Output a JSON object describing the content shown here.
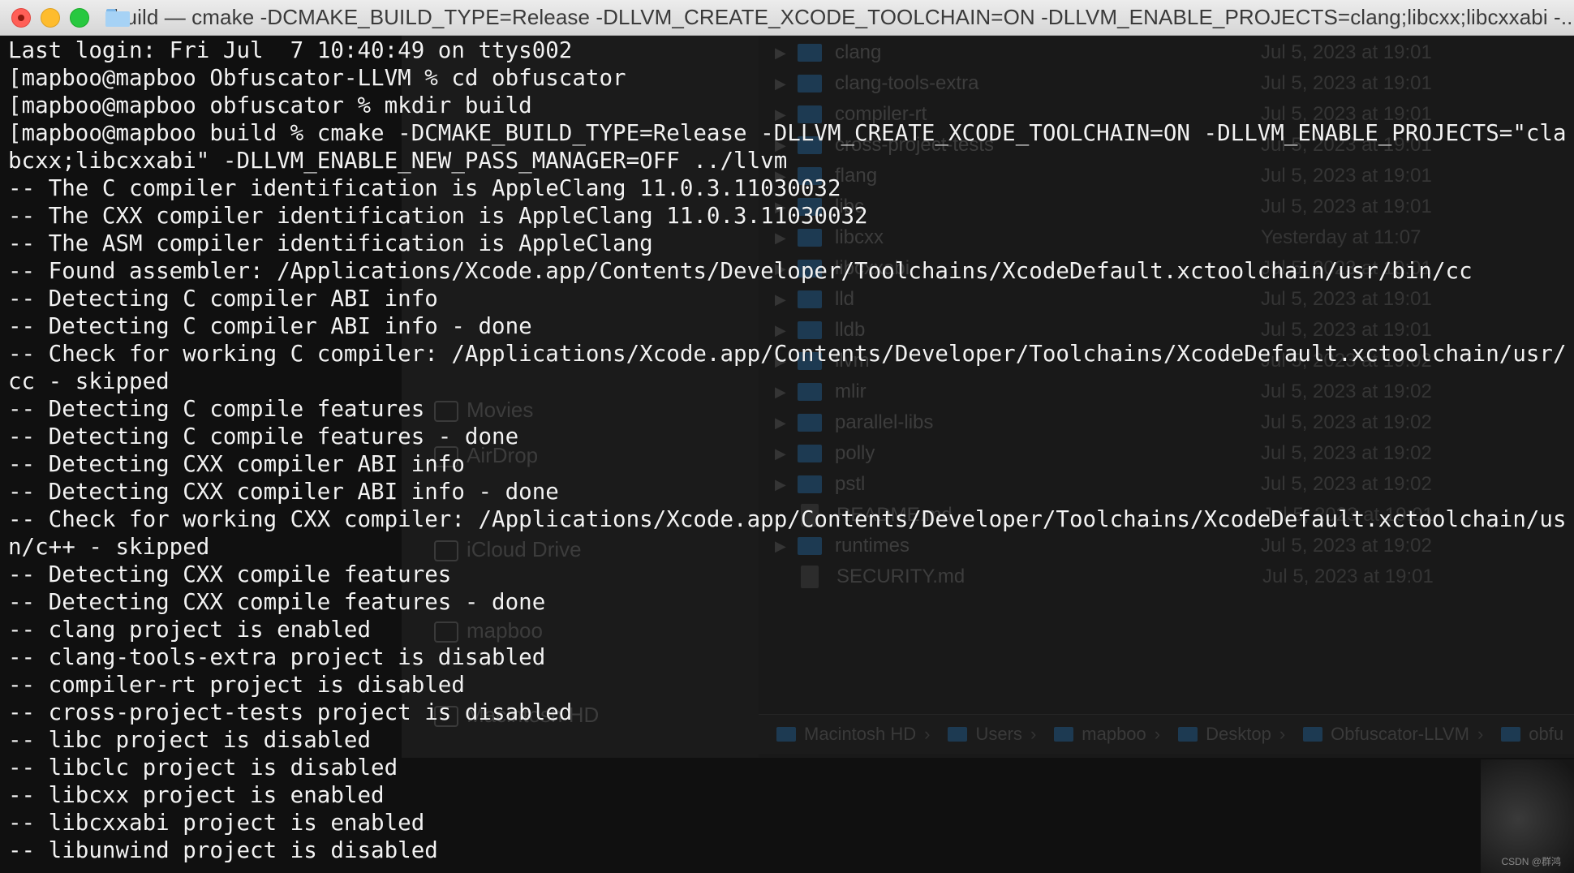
{
  "window": {
    "title": "build — cmake -DCMAKE_BUILD_TYPE=Release -DLLVM_CREATE_XCODE_TOOLCHAIN=ON -DLLVM_ENABLE_PROJECTS=clang;libcxx;libcxxabi -..."
  },
  "terminal": {
    "lines": [
      "Last login: Fri Jul  7 10:40:49 on ttys002",
      "[mapboo@mapboo Obfuscator-LLVM % cd obfuscator",
      "[mapboo@mapboo obfuscator % mkdir build",
      "[mapboo@mapboo build % cmake -DCMAKE_BUILD_TYPE=Release -DLLVM_CREATE_XCODE_TOOLCHAIN=ON -DLLVM_ENABLE_PROJECTS=\"clang;li",
      "bcxx;libcxxabi\" -DLLVM_ENABLE_NEW_PASS_MANAGER=OFF ../llvm",
      "-- The C compiler identification is AppleClang 11.0.3.11030032",
      "-- The CXX compiler identification is AppleClang 11.0.3.11030032",
      "-- The ASM compiler identification is AppleClang",
      "-- Found assembler: /Applications/Xcode.app/Contents/Developer/Toolchains/XcodeDefault.xctoolchain/usr/bin/cc",
      "-- Detecting C compiler ABI info",
      "-- Detecting C compiler ABI info - done",
      "-- Check for working C compiler: /Applications/Xcode.app/Contents/Developer/Toolchains/XcodeDefault.xctoolchain/usr/bin/",
      "cc - skipped",
      "-- Detecting C compile features",
      "-- Detecting C compile features - done",
      "-- Detecting CXX compiler ABI info",
      "-- Detecting CXX compiler ABI info - done",
      "-- Check for working CXX compiler: /Applications/Xcode.app/Contents/Developer/Toolchains/XcodeDefault.xctoolchain/usr/bi",
      "n/c++ - skipped",
      "-- Detecting CXX compile features",
      "-- Detecting CXX compile features - done",
      "-- clang project is enabled",
      "-- clang-tools-extra project is disabled",
      "-- compiler-rt project is disabled",
      "-- cross-project-tests project is disabled",
      "-- libc project is disabled",
      "-- libclc project is disabled",
      "-- libcxx project is enabled",
      "-- libcxxabi project is enabled",
      "-- libunwind project is disabled"
    ]
  },
  "background_finder": {
    "sidebar_items": [
      "Movies",
      "AirDrop",
      "iCloud Drive",
      "mapboo",
      "Macintosh HD"
    ],
    "files": [
      {
        "name": "clang",
        "date": "Jul 5, 2023 at 19:01",
        "kind": "folder"
      },
      {
        "name": "clang-tools-extra",
        "date": "Jul 5, 2023 at 19:01",
        "kind": "folder"
      },
      {
        "name": "compiler-rt",
        "date": "Jul 5, 2023 at 19:01",
        "kind": "folder"
      },
      {
        "name": "cross-project-tests",
        "date": "Jul 5, 2023 at 19:01",
        "kind": "folder"
      },
      {
        "name": "flang",
        "date": "Jul 5, 2023 at 19:01",
        "kind": "folder"
      },
      {
        "name": "libc",
        "date": "Jul 5, 2023 at 19:01",
        "kind": "folder"
      },
      {
        "name": "libcxx",
        "date": "Yesterday at 11:07",
        "kind": "folder"
      },
      {
        "name": "libcxxabi",
        "date": "Jul 5, 2023 at 19:01",
        "kind": "folder"
      },
      {
        "name": "lld",
        "date": "Jul 5, 2023 at 19:01",
        "kind": "folder"
      },
      {
        "name": "lldb",
        "date": "Jul 5, 2023 at 19:01",
        "kind": "folder"
      },
      {
        "name": "llvm",
        "date": "Jul 5, 2023 at 19:02",
        "kind": "folder"
      },
      {
        "name": "mlir",
        "date": "Jul 5, 2023 at 19:02",
        "kind": "folder"
      },
      {
        "name": "parallel-libs",
        "date": "Jul 5, 2023 at 19:02",
        "kind": "folder"
      },
      {
        "name": "polly",
        "date": "Jul 5, 2023 at 19:02",
        "kind": "folder"
      },
      {
        "name": "pstl",
        "date": "Jul 5, 2023 at 19:02",
        "kind": "folder"
      },
      {
        "name": "README.md",
        "date": "Jul 5, 2023 at 19:01",
        "kind": "doc"
      },
      {
        "name": "runtimes",
        "date": "Jul 5, 2023 at 19:02",
        "kind": "folder"
      },
      {
        "name": "SECURITY.md",
        "date": "Jul 5, 2023 at 19:01",
        "kind": "doc"
      }
    ],
    "path_bar": [
      "Macintosh HD",
      "Users",
      "mapboo",
      "Desktop",
      "Obfuscator-LLVM",
      "obfu"
    ]
  },
  "watermark": "CSDN @群鸿",
  "colors": {
    "terminal_text": "#f2f2f2",
    "terminal_bg": "#101010",
    "close": "#ff5f57",
    "minimize": "#febc2e",
    "maximize": "#28c840"
  }
}
